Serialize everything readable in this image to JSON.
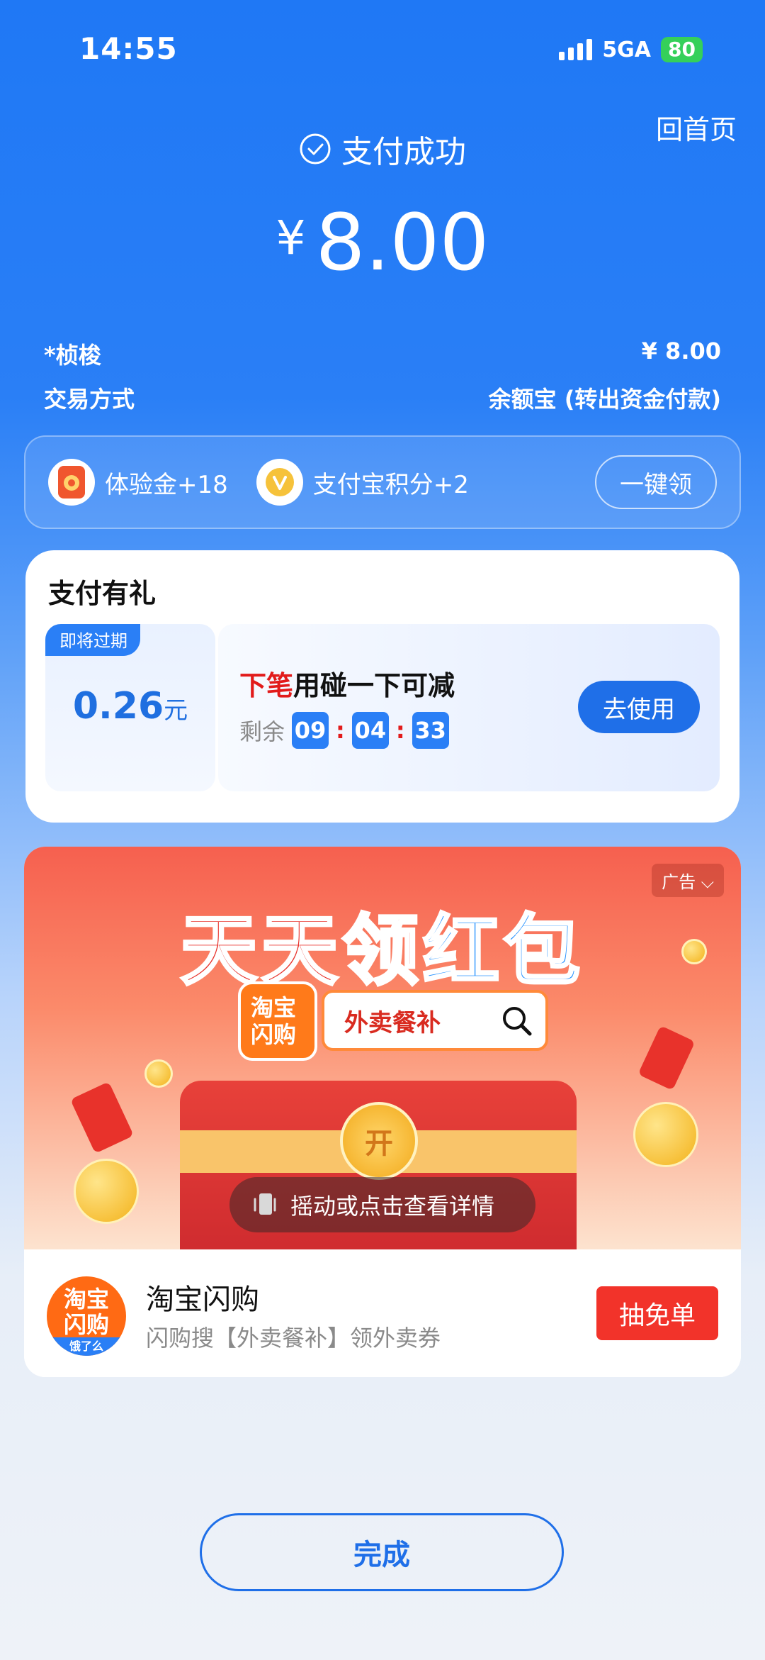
{
  "status_bar": {
    "time": "14:55",
    "network": "5GA",
    "battery": "80"
  },
  "header": {
    "home_link": "回首页",
    "status_title": "支付成功",
    "currency": "¥",
    "amount": "8.00"
  },
  "details": {
    "payee_label": "*桢梭",
    "payee_amount": "¥ 8.00",
    "method_label": "交易方式",
    "method_value": "余额宝 (转出资金付款)"
  },
  "rewards": {
    "items": [
      {
        "label": "体验金+18",
        "icon": "gift-icon"
      },
      {
        "label": "支付宝积分+2",
        "icon": "points-icon"
      }
    ],
    "claim_label": "一键领"
  },
  "gift": {
    "title": "支付有礼",
    "expire_tag": "即将过期",
    "value": "0.26",
    "unit": "元",
    "desc_highlight": "下笔",
    "desc_rest": "用碰一下可减",
    "remaining_label": "剩余",
    "timer": [
      "09",
      "04",
      "33"
    ],
    "use_label": "去使用"
  },
  "ad": {
    "tag": "广告",
    "headline_part1": "天天领",
    "headline_part2": "红包",
    "logo_text": "淘宝闪购",
    "search_text": "外卖餐补",
    "hint": "摇动或点击查看详情",
    "box_seal": "开",
    "app_name": "淘宝闪购",
    "app_desc": "闪购搜【外卖餐补】领外卖券",
    "app_logo_text": "淘宝闪购",
    "app_logo_sub": "饿了么",
    "cta": "抽免单"
  },
  "done_label": "完成",
  "colors": {
    "primary": "#1f78f5",
    "accent_red": "#f2332a",
    "battery_green": "#35d05a"
  }
}
